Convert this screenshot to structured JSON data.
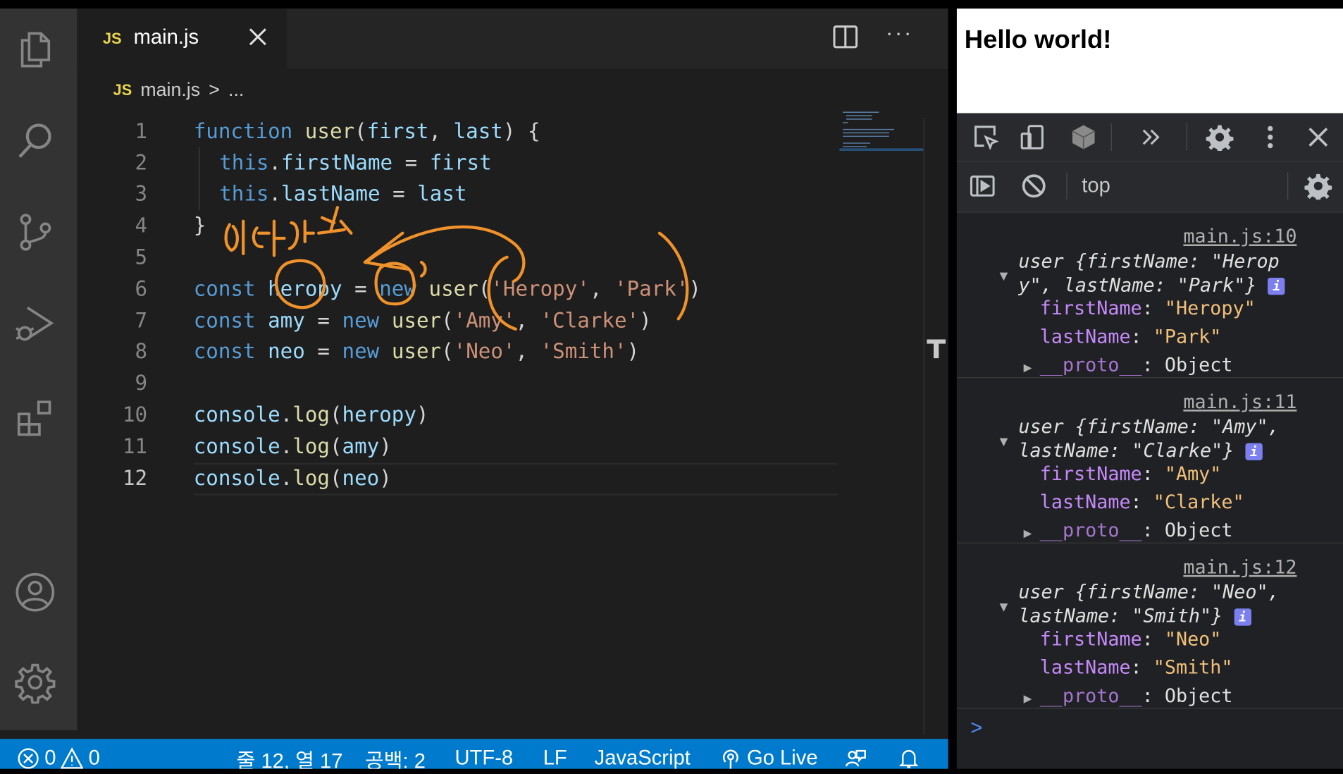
{
  "editor": {
    "tab": {
      "badge": "JS",
      "label": "main.js"
    },
    "breadcrumb": {
      "badge": "JS",
      "file": "main.js",
      "separator": ">",
      "rest": "..."
    },
    "lines": [
      {
        "n": "1"
      },
      {
        "n": "2"
      },
      {
        "n": "3"
      },
      {
        "n": "4"
      },
      {
        "n": "5"
      },
      {
        "n": "6"
      },
      {
        "n": "7"
      },
      {
        "n": "8"
      },
      {
        "n": "9"
      },
      {
        "n": "10"
      },
      {
        "n": "11"
      },
      {
        "n": "12"
      }
    ],
    "code": {
      "l1": [
        "function",
        " ",
        "user",
        "(",
        "first",
        ", ",
        "last",
        ") {"
      ],
      "l2": [
        "this",
        ".",
        "firstName",
        " = ",
        "first"
      ],
      "l3": [
        "this",
        ".",
        "lastName",
        " = ",
        "last"
      ],
      "l4": [
        "}"
      ],
      "l6": [
        "const",
        " ",
        "heropy",
        " = ",
        "new",
        " ",
        "user",
        "(",
        "'Heropy'",
        ", ",
        "'Park'",
        ")"
      ],
      "l7": [
        "const",
        " ",
        "amy",
        " = ",
        "new",
        " ",
        "user",
        "(",
        "'Amy'",
        ", ",
        "'Clarke'",
        ")"
      ],
      "l8": [
        "const",
        " ",
        "neo",
        " = ",
        "new",
        " ",
        "user",
        "(",
        "'Neo'",
        ", ",
        "'Smith'",
        ")"
      ],
      "l10": [
        "console",
        ".",
        "log",
        "(",
        "heropy",
        ")"
      ],
      "l11": [
        "console",
        ".",
        "log",
        "(",
        "amy",
        ")"
      ],
      "l12": [
        "console",
        ".",
        "log",
        "(",
        "neo",
        ")"
      ]
    },
    "handwritten_note": "인스턴스"
  },
  "statusbar": {
    "errors": "0",
    "warnings": "0",
    "position": "줄 12, 열 17",
    "spaces": "공백: 2",
    "encoding": "UTF-8",
    "eol": "LF",
    "language": "JavaScript",
    "golive": "Go Live"
  },
  "browser": {
    "page_heading": "Hello world!",
    "context": "top"
  },
  "console": {
    "entries": [
      {
        "source": "main.js:10",
        "summary_1": "user {firstName: \"Herop",
        "summary_2": "y\", lastName: \"Park\"}",
        "first_key": "firstName",
        "first_val": "\"Heropy\"",
        "last_key": "lastName",
        "last_val": "\"Park\"",
        "proto_key": "__proto__",
        "proto_val": "Object"
      },
      {
        "source": "main.js:11",
        "summary_1": "user {firstName: \"Amy\",",
        "summary_2": "lastName: \"Clarke\"}",
        "first_key": "firstName",
        "first_val": "\"Amy\"",
        "last_key": "lastName",
        "last_val": "\"Clarke\"",
        "proto_key": "__proto__",
        "proto_val": "Object"
      },
      {
        "source": "main.js:12",
        "summary_1": "user {firstName: \"Neo\",",
        "summary_2": "lastName: \"Smith\"}",
        "first_key": "firstName",
        "first_val": "\"Neo\"",
        "last_key": "lastName",
        "last_val": "\"Smith\"",
        "proto_key": "__proto__",
        "proto_val": "Object"
      }
    ],
    "info_badge": "i",
    "prompt": ">"
  },
  "colors": {
    "statusbar": "#007acc",
    "keyword": "#569cd6",
    "function": "#dcdcaa",
    "variable": "#9cdcfe",
    "string": "#ce9178",
    "annotation": "#f0922b"
  },
  "icons": [
    "files-icon",
    "search-icon",
    "source-control-icon",
    "run-debug-icon",
    "extensions-icon",
    "account-icon",
    "settings-gear-icon",
    "close-icon",
    "split-editor-icon",
    "more-icon",
    "error-icon",
    "warning-icon",
    "broadcast-icon",
    "feedback-icon",
    "bell-icon",
    "inspect-icon",
    "device-toolbar-icon",
    "3d-view-icon",
    "more-tabs-icon",
    "settings-icon",
    "kebab-icon",
    "close-devtools-icon",
    "sidebar-toggle-icon",
    "clear-console-icon"
  ]
}
